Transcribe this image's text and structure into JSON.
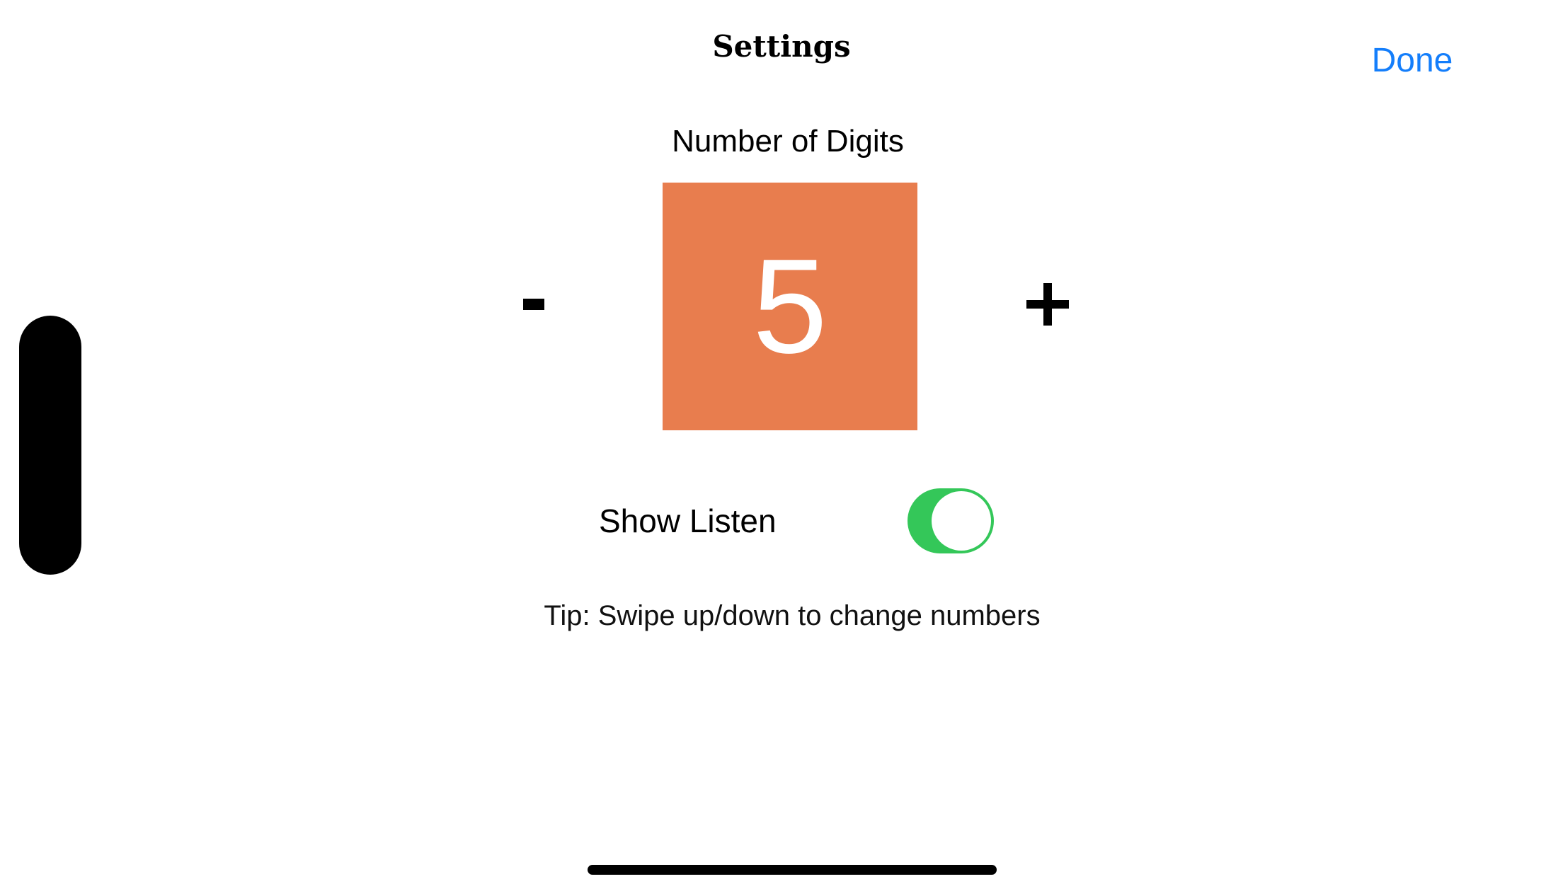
{
  "header": {
    "title": "Settings",
    "done_label": "Done"
  },
  "digits": {
    "label": "Number of Digits",
    "value": "5",
    "decrement_label": "-",
    "increment_label": "+"
  },
  "listen": {
    "label": "Show Listen",
    "enabled": true
  },
  "tip": {
    "text": "Tip: Swipe up/down to change numbers"
  },
  "colors": {
    "accent_blue": "#147efb",
    "digit_box": "#e87d4e",
    "toggle_on": "#34c759"
  },
  "icons": {
    "minus": "minus-icon",
    "plus": "plus-icon"
  }
}
